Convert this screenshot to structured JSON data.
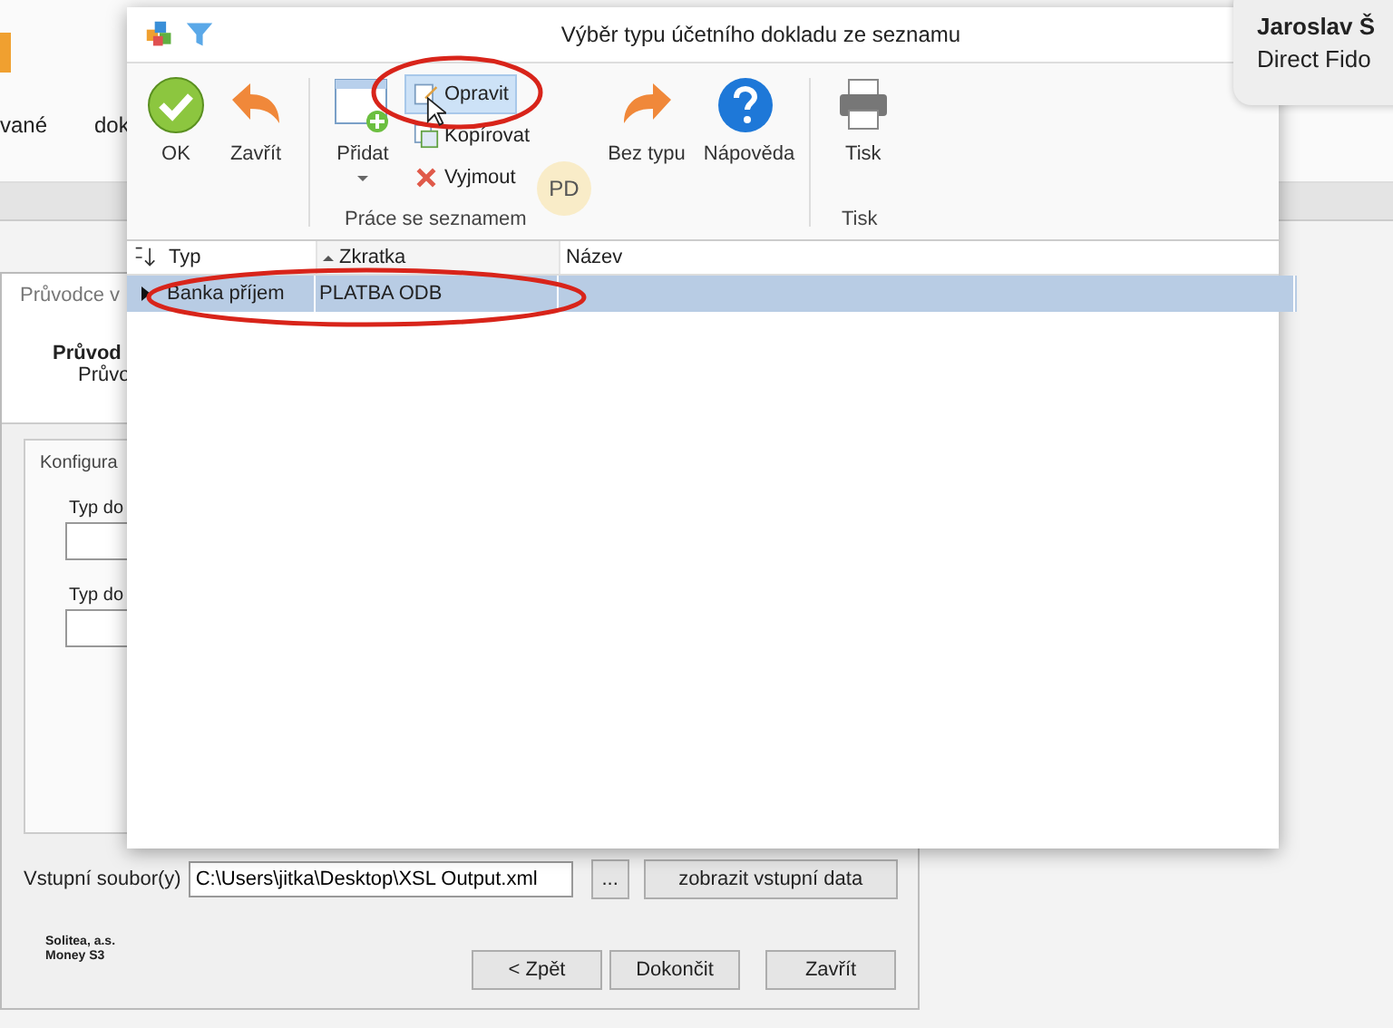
{
  "background_app": {
    "ribbon_labels": [
      "vané",
      "dok"
    ]
  },
  "wizard": {
    "title": "Průvodce v",
    "heading": "Průvod",
    "subheading": "Průvo",
    "group_label": "Konfigura",
    "fields": [
      {
        "label": "Typ do"
      },
      {
        "label": "Typ do"
      }
    ],
    "input_label": "Vstupní soubor(y)",
    "input_value": "C:\\Users\\jitka\\Desktop\\XSL Output.xml",
    "browse_button": "...",
    "show_button": "zobrazit vstupní data",
    "company": [
      "Solitea, a.s.",
      "Money S3"
    ],
    "buttons": [
      "< Zpět",
      "Dokončit",
      "Zavřít"
    ]
  },
  "notification": {
    "name": "Jaroslav Š",
    "subtitle": "Direct Fido"
  },
  "dialog": {
    "title": "Výběr typu účetního dokladu ze seznamu",
    "toolbar": [
      {
        "kind": "large",
        "label": "OK"
      },
      {
        "kind": "large",
        "label": "Zavřít"
      },
      {
        "kind": "separator"
      },
      {
        "kind": "large",
        "label": "Přidat",
        "dropdown": true
      },
      {
        "kind": "stack",
        "items": [
          {
            "label": "Opravit",
            "highlighted": true
          },
          {
            "label": "Kopírovat",
            "highlighted": false
          },
          {
            "label": "Vyjmout",
            "highlighted": false
          }
        ]
      },
      {
        "kind": "large",
        "label": "Bez typu"
      },
      {
        "kind": "large",
        "label": "Nápověda"
      },
      {
        "kind": "separator"
      },
      {
        "kind": "large",
        "label": "Tisk"
      }
    ],
    "groups": [
      "Práce se seznamem",
      "Tisk"
    ],
    "columns": [
      {
        "label": "Typ",
        "sorted": false
      },
      {
        "label": "Zkratka",
        "sorted": true
      },
      {
        "label": "Název",
        "sorted": false
      }
    ],
    "rows": [
      {
        "cells": [
          "Banka příjem",
          "PLATBA ODB",
          ""
        ],
        "selected": true
      }
    ]
  },
  "cursor_badge": "PD"
}
